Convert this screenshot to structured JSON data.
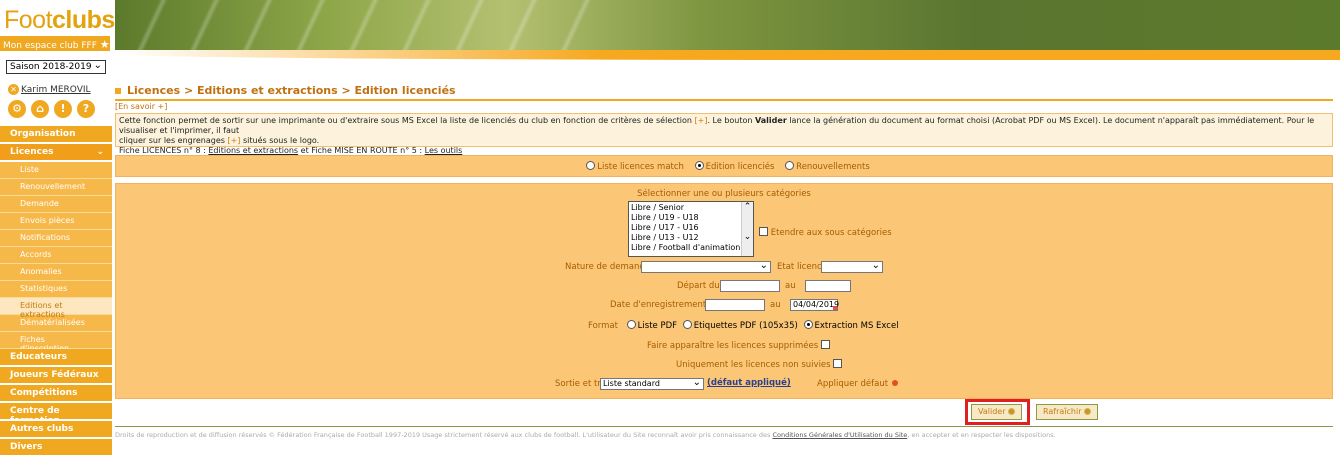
{
  "logo": {
    "brand_plain": "Foot",
    "brand_bold": "clubs",
    "slogan": "Mon espace club FFF"
  },
  "sidebar": {
    "season": "Saison 2018-2019",
    "user": "Karim MEROVIL",
    "tool_icons": [
      "help-circle-icon",
      "logo-icon",
      "alert-icon",
      "question-icon"
    ],
    "menu": [
      {
        "label": "Organisation",
        "type": "head"
      },
      {
        "label": "Licences",
        "type": "head-open"
      },
      {
        "label": "Liste",
        "type": "sub"
      },
      {
        "label": "Renouvellement",
        "type": "sub"
      },
      {
        "label": "Demande",
        "type": "sub"
      },
      {
        "label": "Envois pièces",
        "type": "sub"
      },
      {
        "label": "Notifications",
        "type": "sub"
      },
      {
        "label": "Accords",
        "type": "sub"
      },
      {
        "label": "Anomalies",
        "type": "sub"
      },
      {
        "label": "Statistiques",
        "type": "sub"
      },
      {
        "label": "Editions et extractions",
        "type": "sub-active"
      },
      {
        "label": "Dématérialisées",
        "type": "sub"
      },
      {
        "label": "Fiches d'inscription",
        "type": "sub"
      },
      {
        "label": "Educateurs",
        "type": "head"
      },
      {
        "label": "Joueurs Fédéraux",
        "type": "head"
      },
      {
        "label": "Compétitions",
        "type": "head"
      },
      {
        "label": "Centre de formation",
        "type": "head"
      },
      {
        "label": "Autres clubs",
        "type": "head"
      },
      {
        "label": "Divers",
        "type": "head"
      }
    ]
  },
  "main": {
    "breadcrumb": "Licences > Editions et extractions > Edition licenciés",
    "en_savoir": "[En savoir +]",
    "info": {
      "p1a": "Cette fonction permet de sortir sur une imprimante ou d'extraire sous MS Excel la liste de licenciés du club en fonction de critères de sélection",
      "p1b": "[+]",
      "p1c": ". Le bouton",
      "p1d": "Valider",
      "p1e": "lance la génération du document au format choisi (Acrobat PDF ou MS Excel). Le document n'apparaît pas immédiatement. Pour le visualiser et l'imprimer, il faut",
      "p2a": "cliquer sur les engrenages",
      "p2b": "[+]",
      "p2c": "situés sous le logo.",
      "p3a": "Fiche LICENCES n° 8 :",
      "p3b": "Editions et extractions",
      "p3c": "et Fiche MISE EN ROUTE n° 5 :",
      "p3d": "Les outils"
    },
    "mode_radios": [
      {
        "label": "Liste licences match",
        "checked": false
      },
      {
        "label": "Edition licenciés",
        "checked": true
      },
      {
        "label": "Renouvellements",
        "checked": false
      }
    ],
    "form": {
      "categories_title": "Sélectionner une ou plusieurs catégories",
      "categories": [
        "Libre / Senior",
        "Libre / U19 - U18",
        "Libre / U17 - U16",
        "Libre / U13 - U12",
        "Libre / Football d'animation"
      ],
      "etendre_label": "Etendre aux sous catégories",
      "nature_label": "Nature de demande",
      "nature_value": "",
      "etat_label": "Etat licence",
      "etat_value": "",
      "depart_label": "Départ du",
      "depart_from": "",
      "au_label": "au",
      "depart_to": "",
      "date_label": "Date d'enregistrement du",
      "date_from": "",
      "date_to": "04/04/2019",
      "format_label": "Format",
      "formats": [
        {
          "label": "Liste PDF",
          "checked": false
        },
        {
          "label": "Etiquettes PDF (105x35)",
          "checked": false
        },
        {
          "label": "Extraction MS Excel",
          "checked": true
        }
      ],
      "supprimees_label": "Faire apparaître les licences supprimées",
      "non_suivies_label": "Uniquement les licences non suivies",
      "sortie_label": "Sortie et tri",
      "sortie_value": "Liste standard",
      "defaut_link": "(défaut appliqué)",
      "appliquer_label": "Appliquer défaut"
    },
    "buttons": {
      "valider": "Valider",
      "rafraichir": "Rafraîchir"
    },
    "footer": {
      "text1": "Droits de reproduction et de diffusion réservés © Fédération Française de Football 1997-2019 Usage strictement réservé aux clubs de football. L'utilisateur du Site reconnaît avoir pris connaissance des",
      "link": "Conditions Générales d'Utilisation du Site",
      "text2": ", en accepter et en respecter les dispositions."
    }
  },
  "colors": {
    "orange": "#f0a820",
    "panel": "#fbc776",
    "highlight_border": "#e02020"
  }
}
